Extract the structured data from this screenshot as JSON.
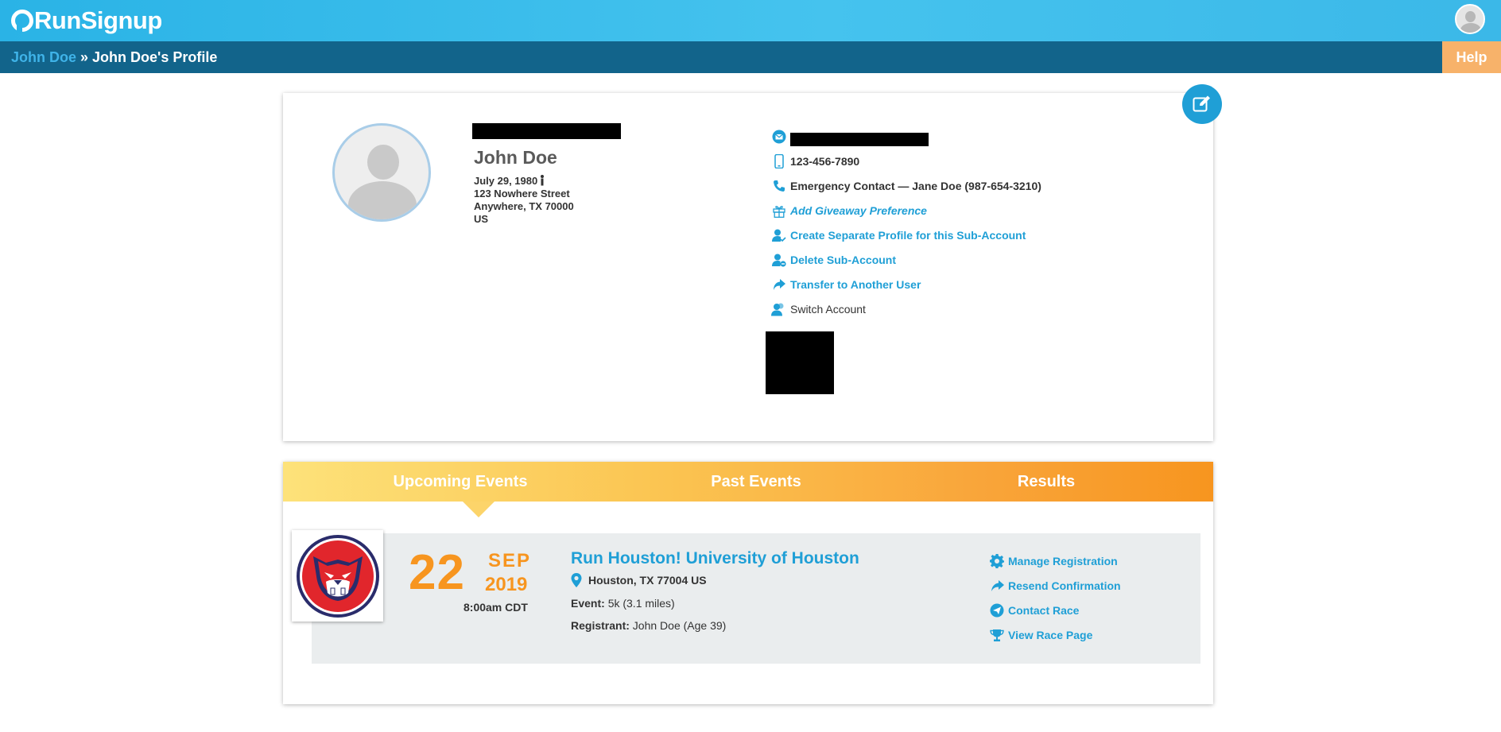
{
  "header": {
    "logo_text": "RunSignup"
  },
  "breadcrumb": {
    "user_link": "John Doe",
    "separator": " » ",
    "current": "John Doe's Profile"
  },
  "help_label": "Help",
  "profile": {
    "name": "John Doe",
    "birthdate": "July 29, 1980",
    "address_line1": "123 Nowhere Street",
    "address_line2": "Anywhere, TX 70000",
    "country": "US"
  },
  "contact": {
    "phone": "123-456-7890",
    "emergency_contact": "Emergency Contact — Jane Doe (987-654-3210)",
    "add_giveaway": "Add Giveaway Preference",
    "create_profile": "Create Separate Profile for this Sub-Account",
    "delete_sub": "Delete Sub-Account",
    "transfer": "Transfer to Another User",
    "switch_account": "Switch Account"
  },
  "tabs": [
    {
      "label": "Upcoming Events"
    },
    {
      "label": "Past Events"
    },
    {
      "label": "Results"
    }
  ],
  "event": {
    "day": "22",
    "month": "SEP",
    "year": "2019",
    "time": "8:00am CDT",
    "title": "Run Houston! University of Houston",
    "location": "Houston, TX 77004 US",
    "event_label": "Event:",
    "event_value": "5k (3.1 miles)",
    "registrant_label": "Registrant:",
    "registrant_value": "John Doe (Age 39)",
    "actions": {
      "manage": "Manage Registration",
      "resend": "Resend Confirmation",
      "contact": "Contact Race",
      "view": "View Race Page"
    }
  },
  "colors": {
    "brand_blue": "#1f9fd6",
    "nav_dark": "#12648b",
    "accent_orange": "#f7951f",
    "help_orange": "#f7b26a"
  }
}
